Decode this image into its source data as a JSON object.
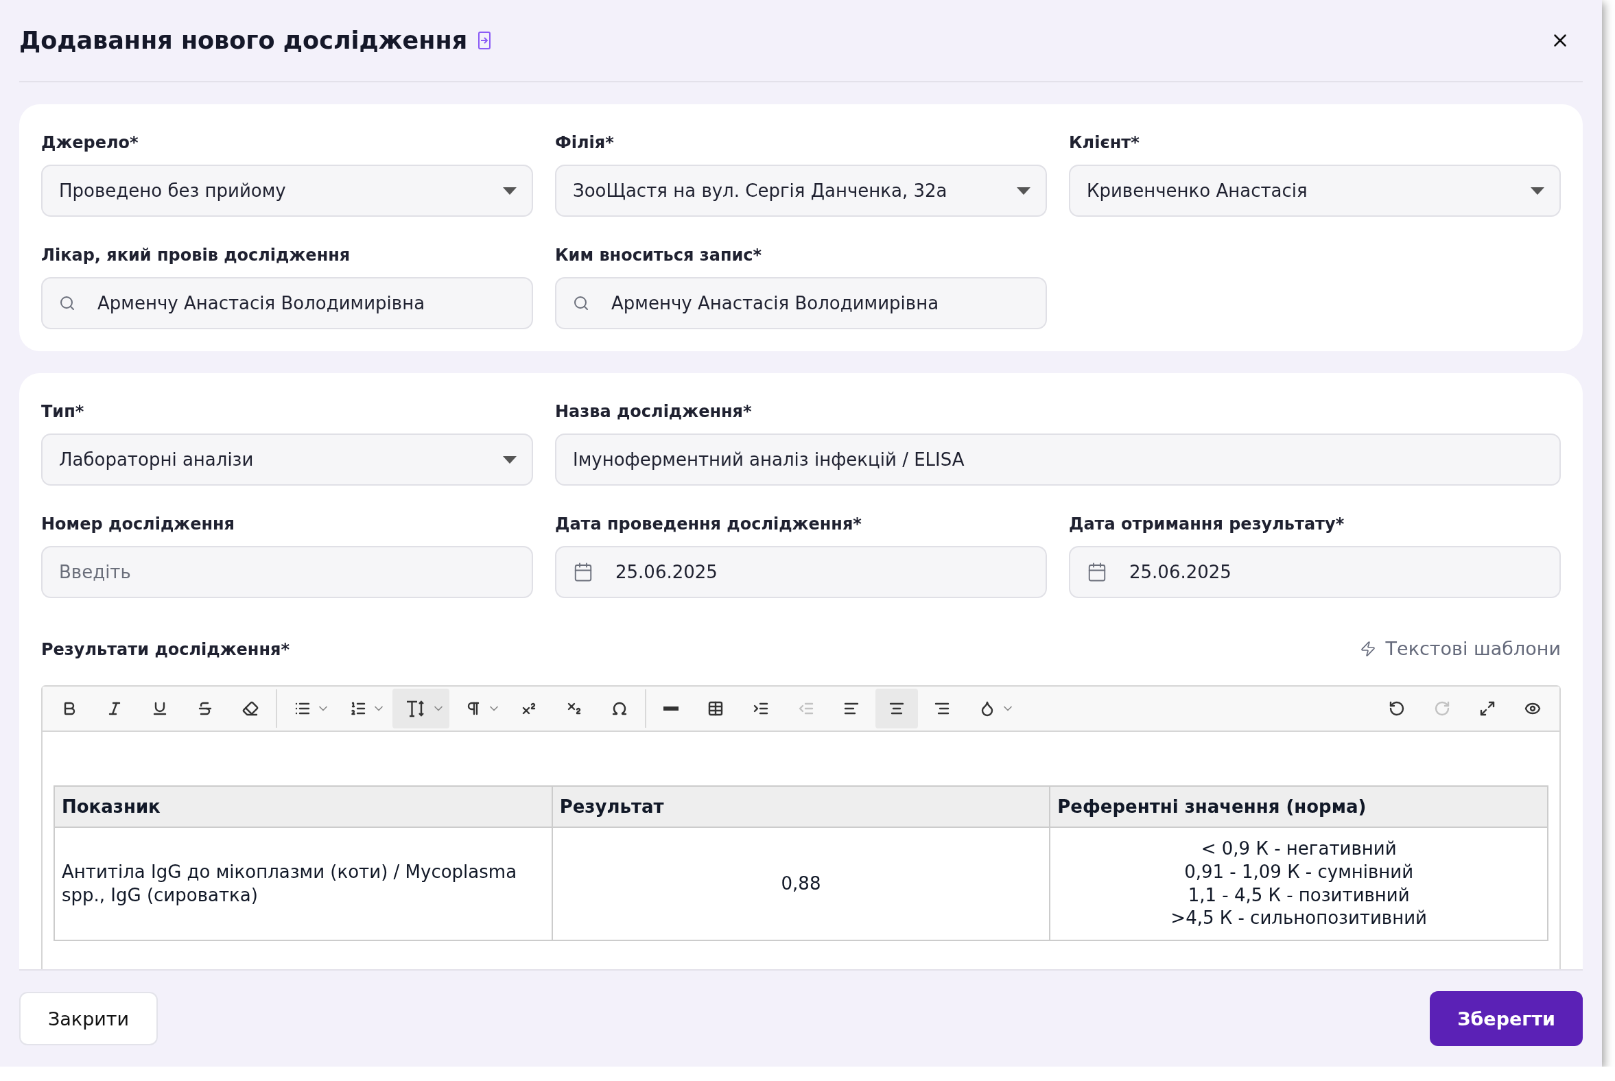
{
  "dialog": {
    "title": "Додавання нового дослідження"
  },
  "sections": [
    {
      "rows": [
        [
          {
            "label": "Джерело*",
            "kind": "select",
            "value": "Проведено без прийому",
            "wide": false
          },
          {
            "label": "Філія*",
            "kind": "select",
            "value": "ЗооЩастя на вул. Сергія Данченка, 32а",
            "wide": false
          },
          {
            "label": "Клієнт*",
            "kind": "select",
            "value": "Кривенченко Анастасія",
            "wide": false
          }
        ],
        [
          {
            "label": "Лікар, який провів дослідження",
            "kind": "search",
            "value": "Арменчу Анастасія Володимирівна",
            "wide": false
          },
          {
            "label": "Ким вноситься запис*",
            "kind": "search",
            "value": "Арменчу Анастасія Володимирівна",
            "wide": false
          }
        ]
      ]
    },
    {
      "rows": [
        [
          {
            "label": "Тип*",
            "kind": "select",
            "value": "Лабораторні аналізи",
            "wide": false
          },
          {
            "label": "Назва дослідження*",
            "kind": "text",
            "value": "Імуноферментний аналіз інфекцій / ELISA",
            "wide": true
          }
        ],
        [
          {
            "label": "Номер дослідження",
            "kind": "text",
            "placeholder": "Введіть",
            "wide": false
          },
          {
            "label": "Дата проведення дослідження*",
            "kind": "date",
            "value": "25.06.2025",
            "wide": false
          },
          {
            "label": "Дата отримання результату*",
            "kind": "date",
            "value": "25.06.2025",
            "wide": false
          }
        ]
      ]
    }
  ],
  "editor": {
    "label": "Результати дослідження*",
    "templates_link": "Текстові шаблони",
    "toolbar": {
      "groups": [
        {
          "items": [
            {
              "kind": "bold",
              "menu": false,
              "selected": false,
              "disabled": false
            },
            {
              "kind": "italic",
              "menu": false,
              "selected": false,
              "disabled": false
            },
            {
              "kind": "underline",
              "menu": false,
              "selected": false,
              "disabled": false
            },
            {
              "kind": "strike",
              "menu": false,
              "selected": false,
              "disabled": false
            },
            {
              "kind": "eraser",
              "menu": false,
              "selected": false,
              "disabled": false
            }
          ]
        },
        {
          "items": [
            {
              "kind": "bullets",
              "menu": true,
              "selected": false,
              "disabled": false
            },
            {
              "kind": "numbers",
              "menu": true,
              "selected": false,
              "disabled": false
            },
            {
              "kind": "fontsize",
              "menu": true,
              "selected": true,
              "disabled": false
            },
            {
              "kind": "paragraph",
              "menu": true,
              "selected": false,
              "disabled": false
            },
            {
              "kind": "superscript",
              "menu": false,
              "selected": false,
              "disabled": false
            },
            {
              "kind": "subscript",
              "menu": false,
              "selected": false,
              "disabled": false
            },
            {
              "kind": "symbol",
              "menu": false,
              "selected": false,
              "disabled": false
            }
          ]
        },
        {
          "items": [
            {
              "kind": "rule",
              "menu": false,
              "selected": false,
              "disabled": false
            },
            {
              "kind": "table",
              "menu": false,
              "selected": false,
              "disabled": false
            },
            {
              "kind": "indent",
              "menu": false,
              "selected": false,
              "disabled": false
            },
            {
              "kind": "outdent",
              "menu": false,
              "selected": false,
              "disabled": true
            },
            {
              "kind": "left",
              "menu": false,
              "selected": false,
              "disabled": false
            },
            {
              "kind": "center",
              "menu": false,
              "selected": true,
              "disabled": false
            },
            {
              "kind": "right",
              "menu": false,
              "selected": false,
              "disabled": false
            },
            {
              "kind": "color",
              "menu": true,
              "selected": false,
              "disabled": false
            }
          ]
        }
      ],
      "right": [
        {
          "kind": "undo",
          "menu": false,
          "selected": false,
          "disabled": false
        },
        {
          "kind": "redo",
          "menu": false,
          "selected": false,
          "disabled": true
        },
        {
          "kind": "fullscreen",
          "menu": false,
          "selected": false,
          "disabled": false
        },
        {
          "kind": "preview",
          "menu": false,
          "selected": false,
          "disabled": false
        }
      ]
    },
    "table": {
      "columns": [
        "Показник",
        "Результат",
        "Референтні значення (норма)"
      ],
      "rows": [
        [
          {
            "lines": [
              "Антитіла IgG до мікоплазми (коти) / Mycoplasma spp., IgG (сироватка)"
            ]
          },
          {
            "lines": [
              "0,88"
            ]
          },
          {
            "lines": [
              "< 0,9 К - негативний",
              "0,91 - 1,09 К - сумнівний",
              "1,1 - 4,5 К - позитивний",
              ">4,5 К - сильнопозитивний"
            ]
          }
        ]
      ]
    }
  },
  "footer": {
    "cancel": "Закрити",
    "save": "Зберегти"
  }
}
